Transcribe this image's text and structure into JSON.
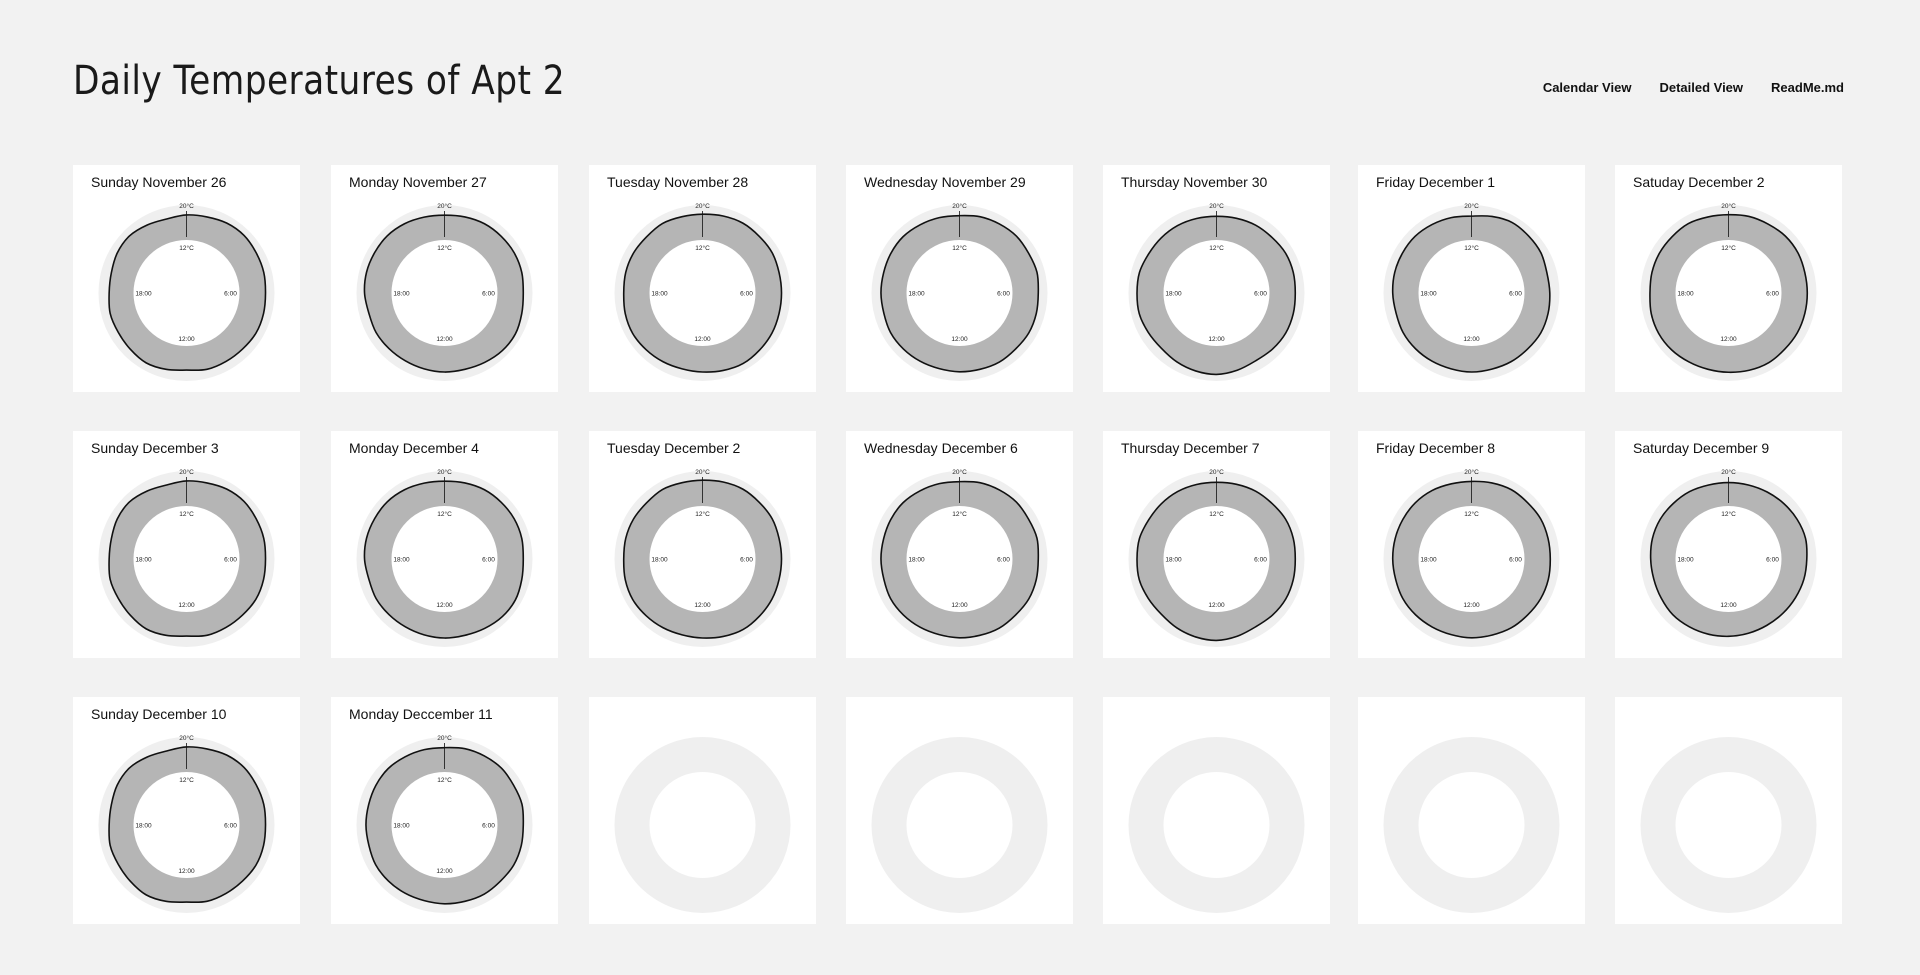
{
  "page": {
    "title": "Daily Temperatures of Apt 2",
    "nav": [
      "Calendar View",
      "Detailed View",
      "ReadMe.md"
    ]
  },
  "chart_data": {
    "type": "radial-area",
    "scale_labels": {
      "outer": "20°C",
      "inner": "12°C"
    },
    "time_labels": {
      "top": "",
      "right": "6:00",
      "bottom": "12:00",
      "left": "18:00"
    },
    "hours": [
      0,
      1,
      2,
      3,
      4,
      5,
      6,
      7,
      8,
      9,
      10,
      11,
      12,
      13,
      14,
      15,
      16,
      17,
      18,
      19,
      20,
      21,
      22,
      23
    ],
    "days": [
      {
        "label": "Sunday November 26",
        "temps": [
          17.5,
          17.8,
          18.6,
          18.9,
          18.5,
          18.3,
          17.9,
          18.2,
          18.4,
          18.0,
          17.9,
          17.9,
          17.1,
          17.9,
          18.6,
          18.1,
          17.8,
          17.9,
          17.2,
          17.4,
          18.3,
          18.6,
          17.7,
          16.9
        ]
      },
      {
        "label": "Monday November 27",
        "temps": [
          17.4,
          17.8,
          18.3,
          18.4,
          18.5,
          18.3,
          17.8,
          18.3,
          19.1,
          19.0,
          18.4,
          17.9,
          17.9,
          17.7,
          17.6,
          17.7,
          17.9,
          17.6,
          18.3,
          18.6,
          18.6,
          18.7,
          18.3,
          17.7
        ]
      },
      {
        "label": "Tuesday November 28",
        "temps": [
          17.8,
          18.2,
          18.6,
          18.4,
          18.5,
          18.0,
          17.9,
          18.0,
          18.4,
          18.6,
          18.9,
          18.4,
          17.9,
          17.7,
          18.0,
          18.3,
          18.6,
          18.3,
          17.8,
          18.1,
          18.2,
          18.0,
          18.4,
          17.9
        ]
      },
      {
        "label": "Wednesday November 29",
        "temps": [
          17.2,
          17.9,
          18.2,
          18.5,
          18.2,
          18.4,
          17.8,
          18.1,
          18.3,
          18.0,
          18.2,
          17.9,
          17.8,
          17.6,
          17.8,
          18.0,
          18.1,
          17.6,
          17.7,
          17.7,
          18.0,
          18.2,
          17.8,
          17.5
        ]
      },
      {
        "label": "Thursday November 30",
        "temps": [
          16.9,
          17.2,
          17.6,
          17.7,
          18.2,
          18.1,
          17.8,
          18.1,
          18.3,
          18.0,
          17.6,
          18.3,
          18.9,
          18.6,
          18.1,
          17.5,
          17.8,
          18.3,
          18.1,
          18.2,
          17.6,
          17.5,
          17.4,
          17.1
        ]
      },
      {
        "label": "Friday December 1",
        "temps": [
          17.0,
          18.0,
          18.9,
          18.6,
          18.4,
          17.5,
          17.6,
          18.0,
          18.3,
          18.0,
          18.0,
          17.8,
          17.9,
          17.7,
          17.8,
          17.9,
          17.9,
          17.5,
          17.8,
          18.1,
          18.2,
          18.3,
          17.9,
          17.5
        ]
      },
      {
        "label": "Satuday December 2",
        "temps": [
          17.6,
          18.0,
          18.1,
          18.5,
          18.4,
          17.9,
          17.8,
          17.9,
          18.1,
          18.1,
          18.5,
          18.3,
          18.0,
          17.9,
          18.1,
          18.5,
          18.6,
          18.3,
          17.7,
          18.0,
          18.2,
          18.2,
          18.4,
          17.8
        ]
      },
      {
        "label": "Sunday December 3",
        "temps": [
          17.5,
          17.8,
          18.6,
          18.9,
          18.5,
          18.3,
          17.9,
          18.2,
          18.4,
          18.0,
          17.9,
          17.9,
          17.1,
          17.9,
          18.6,
          18.1,
          17.8,
          17.9,
          17.2,
          17.4,
          18.3,
          18.6,
          17.7,
          16.9
        ]
      },
      {
        "label": "Monday December 4",
        "temps": [
          17.4,
          17.8,
          18.3,
          18.4,
          18.5,
          18.3,
          17.8,
          18.3,
          19.1,
          19.0,
          18.4,
          17.9,
          17.9,
          17.7,
          17.6,
          17.7,
          17.9,
          17.6,
          18.3,
          18.6,
          18.6,
          18.7,
          18.3,
          17.7
        ]
      },
      {
        "label": "Tuesday December 2",
        "temps": [
          17.8,
          18.2,
          18.6,
          18.4,
          18.5,
          18.0,
          17.9,
          18.0,
          18.4,
          18.6,
          18.9,
          18.4,
          17.9,
          17.7,
          18.0,
          18.3,
          18.6,
          18.3,
          17.8,
          18.1,
          18.2,
          18.0,
          18.4,
          17.9
        ]
      },
      {
        "label": "Wednesday December 6",
        "temps": [
          17.2,
          17.9,
          18.2,
          18.5,
          18.2,
          18.4,
          17.8,
          18.1,
          18.3,
          18.0,
          18.2,
          17.9,
          17.8,
          17.6,
          17.8,
          18.0,
          18.1,
          17.6,
          17.7,
          17.7,
          18.0,
          18.2,
          17.8,
          17.5
        ]
      },
      {
        "label": "Thursday December 7",
        "temps": [
          16.9,
          17.2,
          17.6,
          17.7,
          18.2,
          18.1,
          17.8,
          18.1,
          18.3,
          18.0,
          17.6,
          18.3,
          18.9,
          18.6,
          18.1,
          17.5,
          17.8,
          18.3,
          18.1,
          18.2,
          17.6,
          17.5,
          17.4,
          17.1
        ]
      },
      {
        "label": "Friday December 8",
        "temps": [
          17.3,
          17.8,
          18.3,
          18.1,
          18.3,
          18.0,
          17.8,
          18.1,
          18.2,
          18.0,
          18.1,
          17.8,
          17.8,
          17.6,
          17.7,
          17.9,
          18.0,
          17.7,
          17.8,
          17.9,
          18.0,
          18.1,
          17.9,
          17.4
        ]
      },
      {
        "label": "Saturday December 9",
        "temps": [
          16.8,
          16.9,
          17.2,
          17.6,
          18.0,
          18.2,
          17.6,
          17.5,
          17.2,
          17.0,
          16.9,
          17.0,
          17.2,
          17.4,
          17.6,
          17.8,
          17.4,
          17.2,
          17.4,
          17.8,
          17.9,
          17.6,
          17.4,
          16.9
        ]
      },
      {
        "label": "Sunday December 10",
        "temps": [
          17.5,
          17.8,
          18.6,
          18.9,
          18.5,
          18.3,
          17.9,
          18.2,
          18.4,
          18.0,
          17.9,
          17.9,
          17.1,
          17.9,
          18.6,
          18.1,
          17.8,
          17.9,
          17.2,
          17.4,
          18.3,
          18.6,
          17.7,
          16.9
        ]
      },
      {
        "label": "Monday Deccember 11",
        "temps": [
          17.2,
          17.9,
          18.2,
          18.5,
          18.2,
          18.4,
          17.8,
          18.1,
          18.3,
          18.0,
          18.2,
          17.9,
          17.8,
          17.6,
          17.8,
          18.0,
          18.1,
          17.6,
          17.7,
          17.7,
          18.0,
          18.2,
          17.8,
          17.5
        ]
      },
      {
        "label": "",
        "temps": []
      },
      {
        "label": "",
        "temps": []
      },
      {
        "label": "",
        "temps": []
      },
      {
        "label": "",
        "temps": []
      },
      {
        "label": "",
        "temps": []
      }
    ]
  }
}
